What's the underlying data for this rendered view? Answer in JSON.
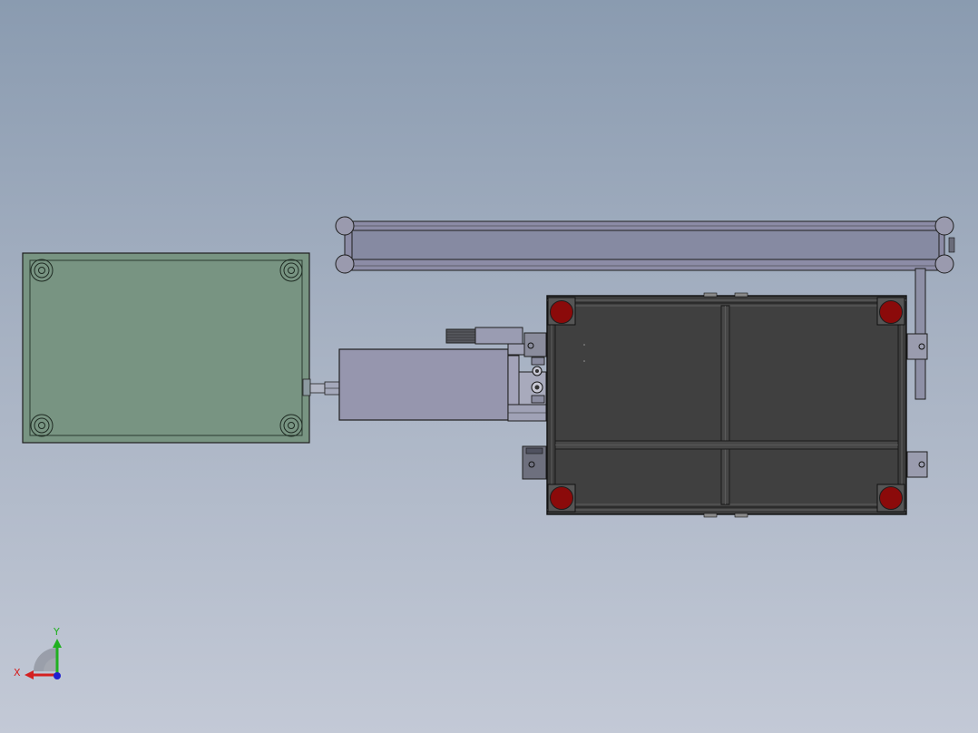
{
  "viewport": {
    "background_top": "#8a9bb0",
    "background_bottom": "#c3c9d6"
  },
  "model": {
    "left_table_color": "#789482",
    "frame_panel_color": "#3c3c3c",
    "feet_color": "#8b0a0a",
    "rail_color": "#8c8ca6",
    "motor_color": "#9696ae"
  },
  "triad": {
    "x_label": "X",
    "y_label": "Y",
    "x_color": "#d42020",
    "y_color": "#20b020",
    "z_color": "#2020d0"
  }
}
